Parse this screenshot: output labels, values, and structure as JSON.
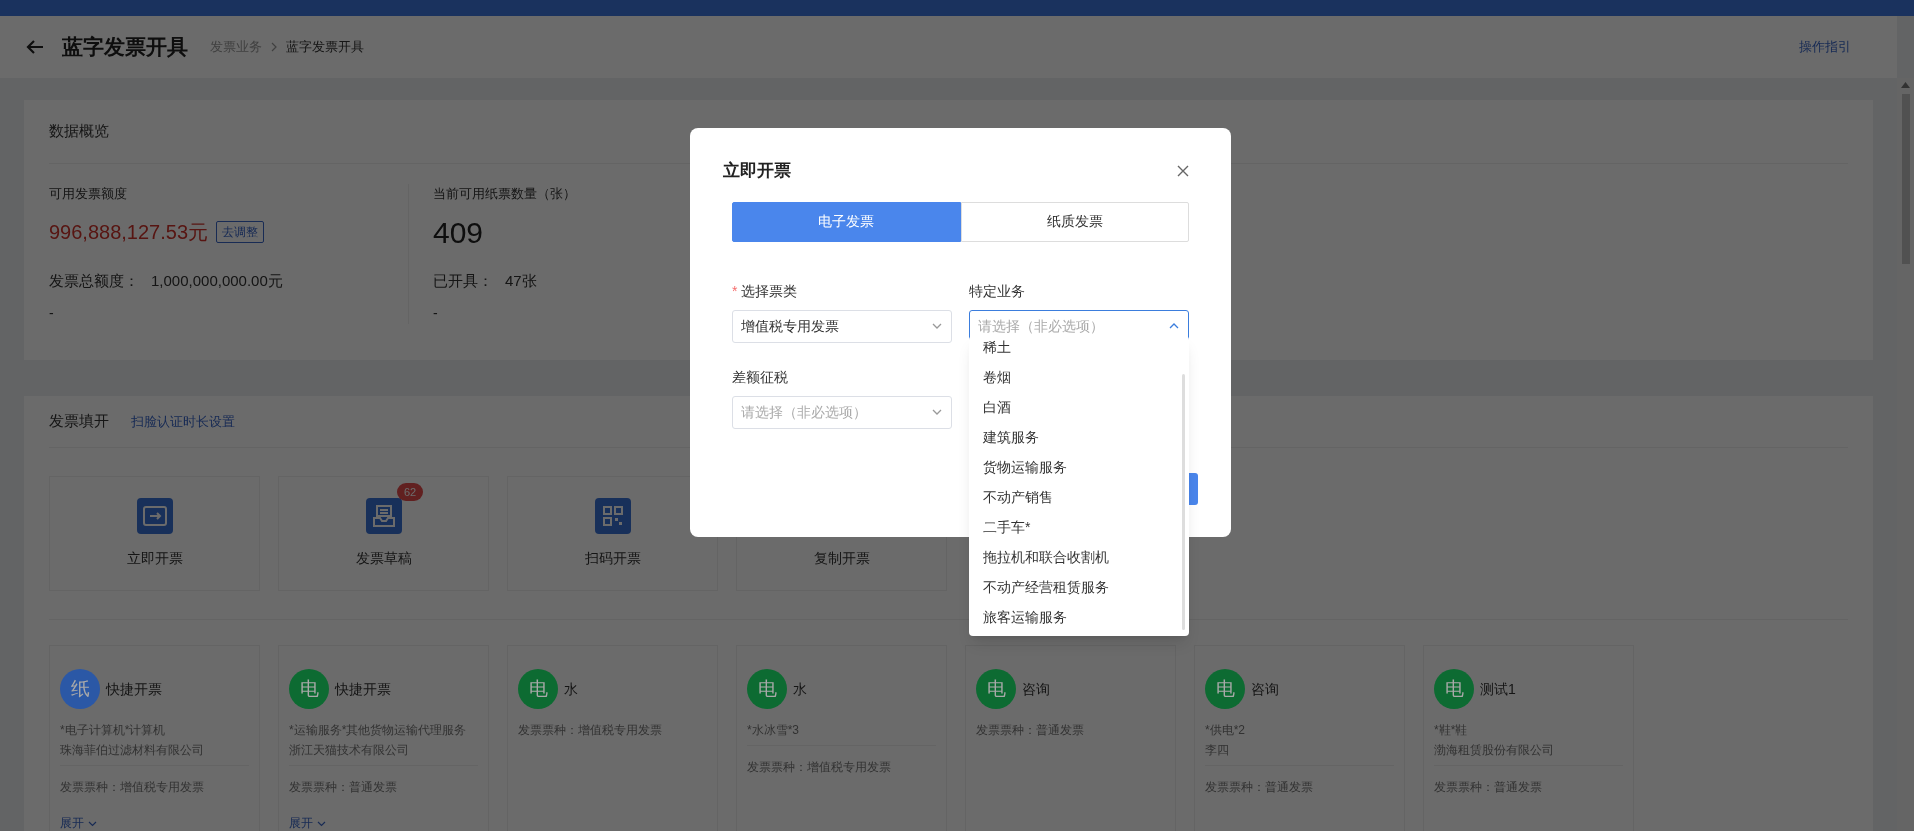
{
  "header": {
    "title": "蓝字发票开具",
    "breadcrumb": [
      {
        "label": "发票业务",
        "current": false
      },
      {
        "label": "蓝字发票开具",
        "current": true
      }
    ],
    "guide_link": "操作指引"
  },
  "overview": {
    "title": "数据概览",
    "stats": [
      {
        "label": "可用发票额度",
        "value": "996,888,127.53元",
        "kind": "money",
        "action": "去调整",
        "sub_label": "发票总额度：",
        "sub_value": "1,000,000,000.00元",
        "note": "-"
      },
      {
        "label": "当前可用纸票数量（张）",
        "value": "409",
        "kind": "count",
        "sub_label": "已开具：",
        "sub_value": "47张",
        "note": "-"
      }
    ]
  },
  "fill": {
    "title": "发票填开",
    "link": "扫脸认证时长设置",
    "actions": [
      {
        "label": "立即开票"
      },
      {
        "label": "发票草稿",
        "badge": "62"
      },
      {
        "label": "扫码开票"
      },
      {
        "label": "复制开票"
      }
    ],
    "templates": [
      {
        "avatar": "纸",
        "color": "#2b58a6",
        "title": "快捷开票",
        "lines": [
          "*电子计算机*计算机",
          "珠海菲伯过滤材料有限公司"
        ],
        "invoice_type": "发票票种：增值税专用发票",
        "expand": "展开"
      },
      {
        "avatar": "电",
        "color": "#0d6b32",
        "title": "快捷开票",
        "lines": [
          "*运输服务*其他货物运输代理服务",
          "浙江天猫技术有限公司"
        ],
        "invoice_type": "发票票种：普通发票",
        "expand": "展开"
      },
      {
        "avatar": "电",
        "color": "#0d6b32",
        "title": "水",
        "invoice_type": "发票票种：增值税专用发票"
      },
      {
        "avatar": "电",
        "color": "#0d6b32",
        "title": "水",
        "lines": [
          "*水冰雪*3"
        ],
        "invoice_type": "发票票种：增值税专用发票"
      },
      {
        "avatar": "电",
        "color": "#0d6b32",
        "title": "咨询",
        "invoice_type": "发票票种：普通发票"
      },
      {
        "avatar": "电",
        "color": "#0d6b32",
        "title": "咨询",
        "lines": [
          "*供电*2",
          "李四"
        ],
        "invoice_type": "发票票种：普通发票"
      },
      {
        "avatar": "电",
        "color": "#0d6b32",
        "title": "测试1",
        "lines": [
          "*鞋*鞋",
          "渤海租赁股份有限公司"
        ],
        "invoice_type": "发票票种：普通发票"
      }
    ]
  },
  "modal": {
    "title": "立即开票",
    "tabs": [
      {
        "label": "电子发票",
        "selected": true
      },
      {
        "label": "纸质发票",
        "selected": false
      }
    ],
    "fields": [
      {
        "label": "选择票类",
        "required_mark": "*",
        "value": "增值税专用发票",
        "open": false
      },
      {
        "label": "特定业务",
        "placeholder": "请选择（非必选项）",
        "open": true
      },
      {
        "label": "差额征税",
        "placeholder": "请选择（非必选项）",
        "open": false
      }
    ],
    "options": [
      "稀土",
      "卷烟",
      "白酒",
      "建筑服务",
      "货物运输服务",
      "不动产销售",
      "二手车*",
      "拖拉机和联合收割机",
      "不动产经营租赁服务",
      "旅客运输服务"
    ]
  }
}
